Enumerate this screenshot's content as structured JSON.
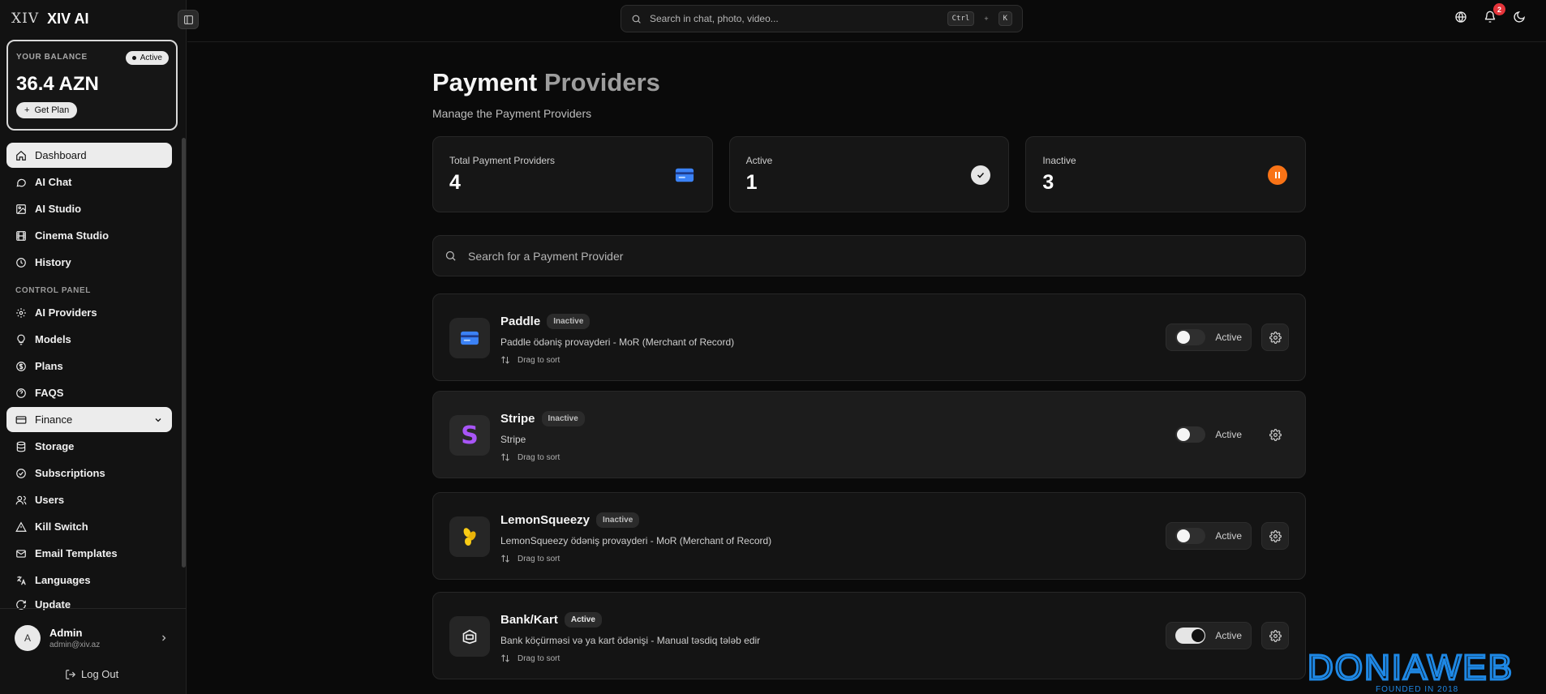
{
  "app": {
    "logo_text": "XIV",
    "name": "XIV AI"
  },
  "balance": {
    "label": "YOUR BALANCE",
    "status": "Active",
    "amount": "36.4 AZN",
    "cta": "Get Plan"
  },
  "sidebar": {
    "items": [
      {
        "label": "Dashboard",
        "icon": "home-icon"
      },
      {
        "label": "AI Chat",
        "icon": "chat-icon"
      },
      {
        "label": "AI Studio",
        "icon": "image-icon"
      },
      {
        "label": "Cinema Studio",
        "icon": "film-icon"
      },
      {
        "label": "History",
        "icon": "clock-icon"
      }
    ],
    "section_label": "CONTROL PANEL",
    "control_items": [
      {
        "label": "AI Providers",
        "icon": "chip-icon"
      },
      {
        "label": "Models",
        "icon": "bulb-icon"
      },
      {
        "label": "Plans",
        "icon": "dollar-icon"
      },
      {
        "label": "FAQS",
        "icon": "help-icon"
      },
      {
        "label": "Finance",
        "icon": "card-icon"
      },
      {
        "label": "Storage",
        "icon": "database-icon"
      },
      {
        "label": "Subscriptions",
        "icon": "check-circle-icon"
      },
      {
        "label": "Users",
        "icon": "users-icon"
      },
      {
        "label": "Kill Switch",
        "icon": "warning-icon"
      },
      {
        "label": "Email Templates",
        "icon": "mail-icon"
      },
      {
        "label": "Languages",
        "icon": "translate-icon"
      },
      {
        "label": "Update",
        "icon": "refresh-icon"
      }
    ]
  },
  "user": {
    "name": "Admin",
    "email": "admin@xiv.az",
    "initial": "A",
    "logout": "Log Out"
  },
  "topbar": {
    "search_placeholder": "Search in chat, photo, video...",
    "shortcut_key1": "Ctrl",
    "shortcut_plus": "+",
    "shortcut_key2": "K",
    "notification_count": "2"
  },
  "page": {
    "title_part1": "Payment",
    "title_part2": "Providers",
    "subtitle": "Manage the Payment Providers"
  },
  "stats": [
    {
      "label": "Total Payment Providers",
      "value": "4",
      "icon": "card-icon",
      "color": "#3b82f6"
    },
    {
      "label": "Active",
      "value": "1",
      "icon": "check-icon",
      "color": "#e5e5e5"
    },
    {
      "label": "Inactive",
      "value": "3",
      "icon": "pause-icon",
      "color": "#f97316"
    }
  ],
  "provider_search": {
    "placeholder": "Search for a Payment Provider"
  },
  "providers": [
    {
      "name": "Paddle",
      "status": "Inactive",
      "description": "Paddle ödəniş provayderi - MoR (Merchant of Record)",
      "drag": "Drag to sort",
      "toggle_label": "Active",
      "enabled": false,
      "icon": "paddle-card-icon",
      "icon_color": "#3b82f6"
    },
    {
      "name": "Stripe",
      "status": "Inactive",
      "description": "Stripe",
      "drag": "Drag to sort",
      "toggle_label": "Active",
      "enabled": false,
      "icon": "stripe-s-icon",
      "icon_color": "#a855f7"
    },
    {
      "name": "LemonSqueezy",
      "status": "Inactive",
      "description": "LemonSqueezy ödəniş provayderi - MoR (Merchant of Record)",
      "drag": "Drag to sort",
      "toggle_label": "Active",
      "enabled": false,
      "icon": "lemon-icon",
      "icon_color": "#facc15"
    },
    {
      "name": "Bank/Kart",
      "status": "Active",
      "description": "Bank köçürməsi və ya kart ödənişi - Manual təsdiq tələb edir",
      "drag": "Drag to sort",
      "toggle_label": "Active",
      "enabled": true,
      "icon": "bank-card-icon",
      "icon_color": "#e5e5e5"
    }
  ],
  "watermark": {
    "text": "DONIAWEB",
    "tagline": "FOUNDED IN 2018",
    "color": "#1e88e5"
  }
}
